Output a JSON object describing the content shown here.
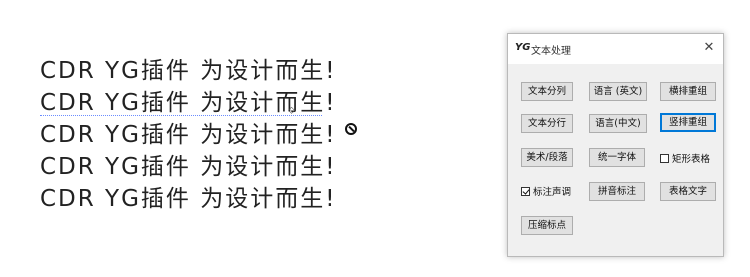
{
  "canvas": {
    "text_lines": [
      "CDR YG插件 为设计而生!",
      "CDR YG插件 为设计而生!",
      "CDR YG插件 为设计而生!",
      "CDR YG插件 为设计而生!",
      "CDR YG插件 为设计而生!"
    ]
  },
  "dialog": {
    "logo": "YG",
    "title": "文本处理",
    "close": "✕",
    "buttons": {
      "split_text": "文本分列",
      "lang_en": "语言 (英文)",
      "horizontal_regroup": "横排重组",
      "split_lines": "文本分行",
      "lang_cn": "语言(中文)",
      "vertical_regroup": "竖排重组",
      "art_paragraph": "美术/段落",
      "unify_font": "统一字体",
      "pinyin": "拼音标注",
      "table_text": "表格文字",
      "compress_punct": "压缩标点"
    },
    "checkboxes": {
      "rect_table": {
        "label": "矩形表格",
        "checked": false
      },
      "tone_marks": {
        "label": "标注声调",
        "checked": true
      }
    }
  }
}
